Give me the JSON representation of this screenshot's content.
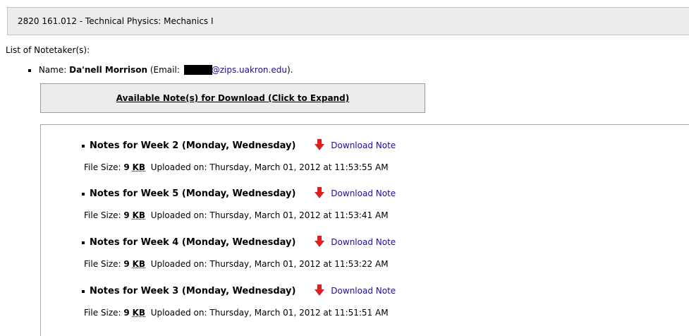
{
  "course": {
    "title": "2820 161.012 - Technical Physics: Mechanics I"
  },
  "notetakers_label": "List of Notetaker(s):",
  "notetaker": {
    "name_label": "Name:",
    "name": "Da'nell Morrison",
    "email_prefix": "(Email:",
    "email_domain": "@zips.uakron.edu",
    "email_suffix": ")."
  },
  "expand": {
    "label": "Available Note(s) for Download (Click to Expand)"
  },
  "notes": [
    {
      "title": "Notes for Week 2 (Monday, Wednesday)",
      "download_label": "Download Note",
      "size_label": "File Size:",
      "size_value": "9",
      "size_unit": "KB",
      "uploaded": "Uploaded on: Thursday, March 01, 2012 at 11:53:55 AM"
    },
    {
      "title": "Notes for Week 5 (Monday, Wednesday)",
      "download_label": "Download Note",
      "size_label": "File Size:",
      "size_value": "9",
      "size_unit": "KB",
      "uploaded": "Uploaded on: Thursday, March 01, 2012 at 11:53:41 AM"
    },
    {
      "title": "Notes for Week 4 (Monday, Wednesday)",
      "download_label": "Download Note",
      "size_label": "File Size:",
      "size_value": "9",
      "size_unit": "KB",
      "uploaded": "Uploaded on: Thursday, March 01, 2012 at 11:53:22 AM"
    },
    {
      "title": "Notes for Week 3 (Monday, Wednesday)",
      "download_label": "Download Note",
      "size_label": "File Size:",
      "size_value": "9",
      "size_unit": "KB",
      "uploaded": "Uploaded on: Thursday, March 01, 2012 at 11:51:51 AM"
    }
  ],
  "icons": {
    "download": "down-arrow-icon"
  },
  "colors": {
    "link": "#1a0dab",
    "arrow": "#e21d1d",
    "header_bg": "#ececec"
  }
}
